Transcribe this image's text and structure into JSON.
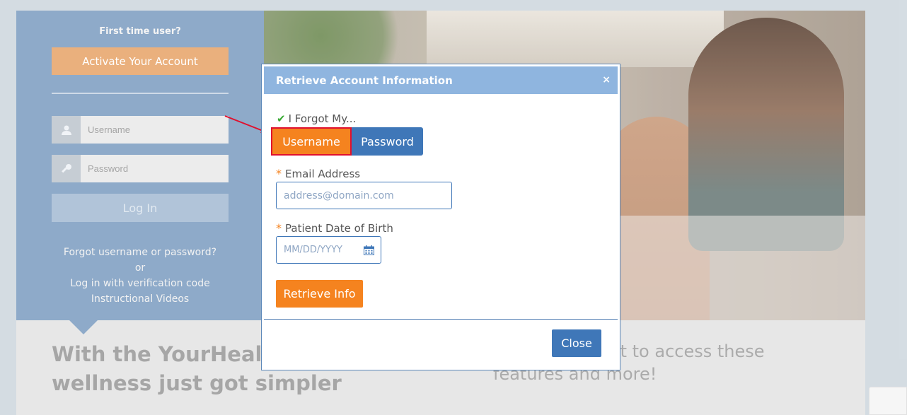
{
  "login_panel": {
    "first_time_label": "First time user?",
    "activate_button": "Activate Your Account",
    "username_placeholder": "Username",
    "password_placeholder": "Password",
    "login_button": "Log In",
    "links": {
      "forgot": "Forgot username or password?",
      "or": "or",
      "verification": "Log in with verification code",
      "videos": "Instructional Videos"
    }
  },
  "marketing": {
    "tagline": "With the YourHealth your path to wellness just got simpler",
    "tagline_right": "te your account to access these features and more!"
  },
  "modal": {
    "title": "Retrieve Account Information",
    "close_x": "×",
    "forgot_label": "I Forgot My...",
    "toggle": {
      "username": "Username",
      "password": "Password",
      "selected": "Username"
    },
    "email_label": "Email Address",
    "email_placeholder": "address@domain.com",
    "dob_label": "Patient Date of Birth",
    "dob_placeholder": "MM/DD/YYYY",
    "retrieve_button": "Retrieve Info",
    "close_button": "Close",
    "required_marker": "*"
  },
  "colors": {
    "primary_blue": "#3f77b8",
    "accent_orange": "#f5831f",
    "highlight_red": "#e0102e"
  }
}
